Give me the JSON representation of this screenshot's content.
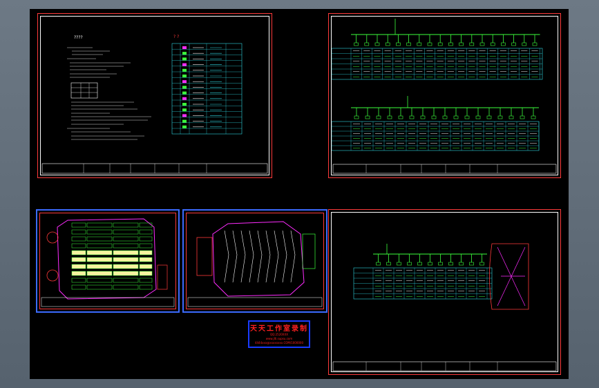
{
  "stamp": {
    "title": "天天工作室录制",
    "line1": "QQ:2520XXX",
    "line2": "www.jlti.supsu.com",
    "line3": "4444xxx@xxxxxxxx.COM/1000000"
  },
  "sheets": {
    "notes_title": "????",
    "legend_title": "? ?"
  },
  "colors": {
    "drawing_bg": "#000000",
    "frame_red": "#ff3a3a",
    "frame_blue": "#3b6bff",
    "line_green": "#3cff3c",
    "line_cyan": "#2fd5e0",
    "line_magenta": "#ff2cff",
    "fill_yellow": "#f7f2a0"
  }
}
